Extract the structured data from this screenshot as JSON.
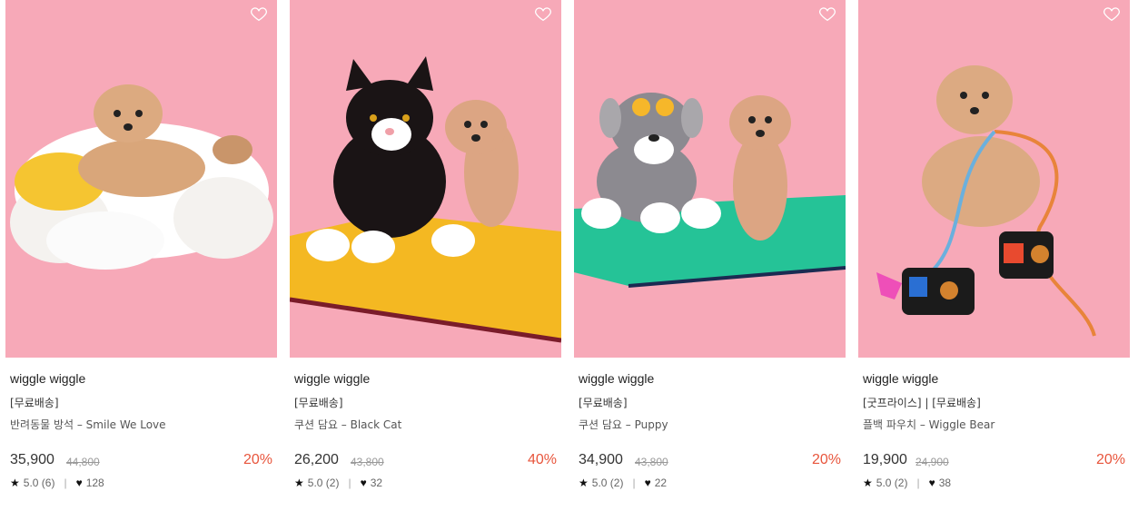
{
  "colors": {
    "card_bg": "#f7a9b8",
    "discount": "#e8553c"
  },
  "products": [
    {
      "brand": "wiggle wiggle",
      "tag": "[무료배송]",
      "name": "반려동물 방석 – Smile We Love",
      "price": "35,900",
      "original_price": "44,800",
      "discount": "20%",
      "rating": "5.0 (6)",
      "likes": "128"
    },
    {
      "brand": "wiggle wiggle",
      "tag": "[무료배송]",
      "name": "쿠션 담요 – Black Cat",
      "price": "26,200",
      "original_price": "43,800",
      "discount": "40%",
      "rating": "5.0 (2)",
      "likes": "32"
    },
    {
      "brand": "wiggle wiggle",
      "tag": "[무료배송]",
      "name": "쿠션 담요 – Puppy",
      "price": "34,900",
      "original_price": "43,800",
      "discount": "20%",
      "rating": "5.0 (2)",
      "likes": "22"
    },
    {
      "brand": "wiggle wiggle",
      "tag": "[굿프라이스] | [무료배송]",
      "name": "플백 파우치 – Wiggle Bear",
      "price": "19,900",
      "original_price": "24,900",
      "discount": "20%",
      "rating": "5.0 (2)",
      "likes": "38"
    }
  ]
}
